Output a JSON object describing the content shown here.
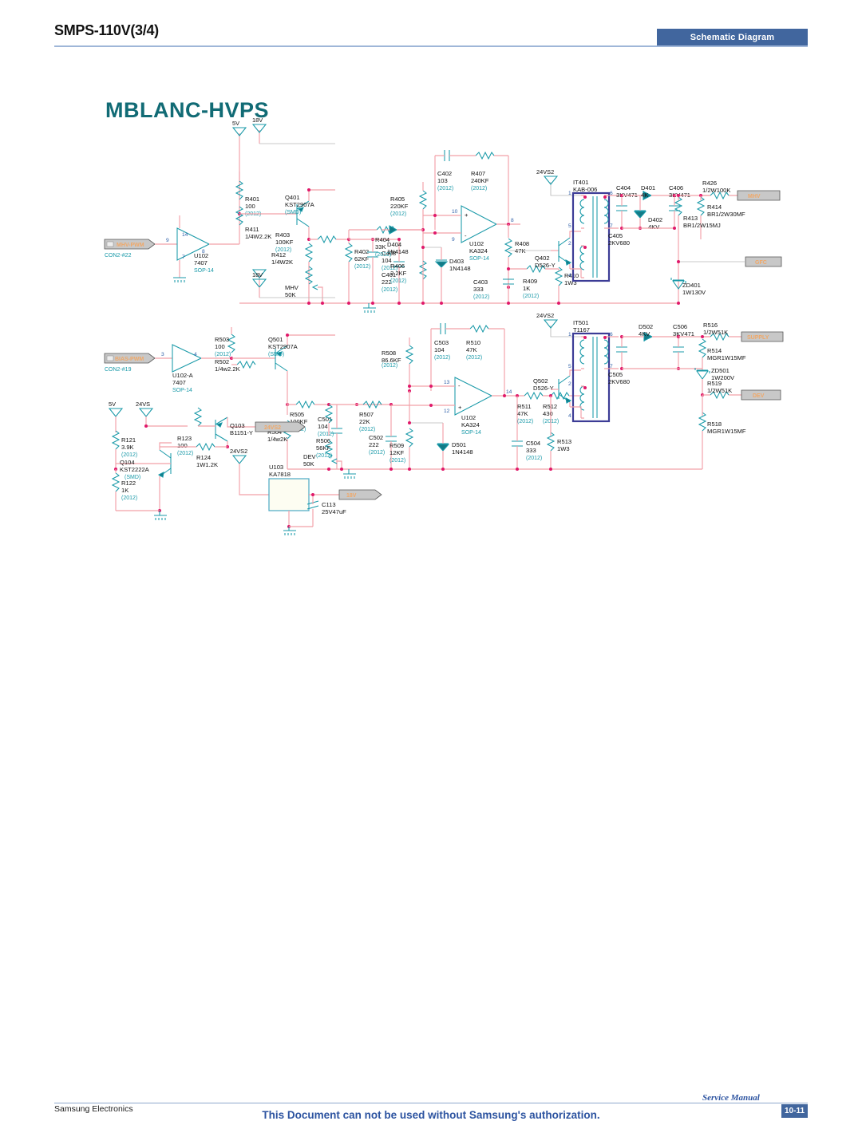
{
  "header": {
    "title": "SMPS-110V(3/4)",
    "badge": "Schematic Diagram"
  },
  "footer": {
    "company": "Samsung Electronics",
    "notice": "This Document can not be used without Samsung's authorization.",
    "manual": "Service Manual",
    "page": "10-11"
  },
  "board": {
    "title": "MBLANC-HVPS"
  },
  "nets": {
    "mhv_pwm": "MHV-PWM",
    "mhv_pwm_con": "CON2-#22",
    "bias_pwm": "BIAS-PWM",
    "bias_pwm_con": "CON2-#19",
    "mhv_out": "MHV",
    "gfc_out": "GFC",
    "supply_out": "SUPPLY",
    "dev_out": "DEV",
    "v24vs2_tag": "24VS2",
    "v18_tag": "18V"
  },
  "rails": {
    "r5v_a": "5V",
    "r18v_a": "18V",
    "r24vs2_a": "24VS2",
    "r18v_b": "18V",
    "r24vs2_b": "24VS2",
    "r5v_c": "5V",
    "r24vs_c": "24VS",
    "r24vs2_c": "24VS2"
  },
  "components": {
    "top": [
      {
        "id": "U102",
        "value": "7407",
        "pkg": "SOP-14",
        "pins": [
          "9",
          "14",
          "8",
          "7"
        ]
      },
      {
        "id": "R401",
        "value": "100",
        "pkg": "(2012)"
      },
      {
        "id": "R411",
        "value": "1/4W2.2K",
        "pkg": ""
      },
      {
        "id": "Q401",
        "value": "KST2907A",
        "pkg": "(SMD)"
      },
      {
        "id": "R403",
        "value": "100KF",
        "pkg": "(2012)"
      },
      {
        "id": "R412",
        "value": "1/4W2K",
        "pkg": ""
      },
      {
        "id": "R402",
        "value": "62KF",
        "pkg": "(2012)"
      },
      {
        "id": "C408",
        "value": "104",
        "pkg": "(2012)"
      },
      {
        "id": "MHV",
        "value": "50K",
        "pkg": ""
      },
      {
        "id": "R404",
        "value": "33K",
        "pkg": "(2012)"
      },
      {
        "id": "C401",
        "value": "222",
        "pkg": "(2012)"
      },
      {
        "id": "R405",
        "value": "220KF",
        "pkg": "(2012)"
      },
      {
        "id": "D404",
        "value": "1N4148",
        "pkg": ""
      },
      {
        "id": "R406",
        "value": "2.2KF",
        "pkg": "(2012)"
      },
      {
        "id": "D403",
        "value": "1N4148",
        "pkg": ""
      },
      {
        "id": "C402",
        "value": "103",
        "pkg": "(2012)"
      },
      {
        "id": "R407",
        "value": "240KF",
        "pkg": "(2012)"
      },
      {
        "id": "U102b",
        "value": "KA324",
        "pkg": "SOP-14",
        "pins": [
          "10",
          "9",
          "8"
        ]
      },
      {
        "id": "R408",
        "value": "47K",
        "pkg": ""
      },
      {
        "id": "C403",
        "value": "333",
        "pkg": "(2012)"
      },
      {
        "id": "R409",
        "value": "1K",
        "pkg": "(2012)"
      },
      {
        "id": "R410",
        "value": "1W3",
        "pkg": ""
      },
      {
        "id": "Q402",
        "value": "D526-Y",
        "pkg": ""
      },
      {
        "id": "IT401",
        "value": "KAB-006",
        "pkg": "",
        "pins": [
          "1",
          "5",
          "2",
          "4",
          "6",
          "7"
        ]
      },
      {
        "id": "C404",
        "value": "3KV471",
        "pkg": ""
      },
      {
        "id": "D401",
        "value": "4K",
        "pkg": ""
      },
      {
        "id": "C406",
        "value": "3KV471",
        "pkg": ""
      },
      {
        "id": "R426",
        "value": "1/2W100K",
        "pkg": ""
      },
      {
        "id": "D402",
        "value": "4KV",
        "pkg": ""
      },
      {
        "id": "C405",
        "value": "2KV680",
        "pkg": ""
      },
      {
        "id": "R414",
        "value": "BR1/2W30MF",
        "pkg": ""
      },
      {
        "id": "R413",
        "value": "BR1/2W15MJ",
        "pkg": ""
      },
      {
        "id": "ZD401",
        "value": "1W130V",
        "pkg": ""
      }
    ],
    "bottom": [
      {
        "id": "U102-A",
        "value": "7407",
        "pkg": "SOP-14",
        "pins": [
          "3",
          "4"
        ]
      },
      {
        "id": "R503",
        "value": "100",
        "pkg": "(2012)"
      },
      {
        "id": "R502",
        "value": "1/4w2.2K",
        "pkg": ""
      },
      {
        "id": "Q501",
        "value": "KST2907A",
        "pkg": "(SMD)"
      },
      {
        "id": "R505",
        "value": "100KF",
        "pkg": "(2012)"
      },
      {
        "id": "R504",
        "value": "1/4w2K",
        "pkg": ""
      },
      {
        "id": "C501",
        "value": "104",
        "pkg": "(2012)"
      },
      {
        "id": "R506",
        "value": "56KF",
        "pkg": "(2012)"
      },
      {
        "id": "DEV",
        "value": "50K",
        "pkg": ""
      },
      {
        "id": "R507",
        "value": "22K",
        "pkg": "(2012)"
      },
      {
        "id": "C502",
        "value": "222",
        "pkg": "(2012)"
      },
      {
        "id": "R508",
        "value": "86.6KF",
        "pkg": "(2012)"
      },
      {
        "id": "R509",
        "value": "12KF",
        "pkg": "(2012)"
      },
      {
        "id": "D501",
        "value": "1N4148",
        "pkg": ""
      },
      {
        "id": "C503",
        "value": "104",
        "pkg": "(2012)"
      },
      {
        "id": "R510",
        "value": "47K",
        "pkg": "(2012)"
      },
      {
        "id": "U102c",
        "value": "KA324",
        "pkg": "SOP-14",
        "pins": [
          "13",
          "12",
          "14"
        ]
      },
      {
        "id": "R511",
        "value": "47K",
        "pkg": "(2012)"
      },
      {
        "id": "R512",
        "value": "430",
        "pkg": "(2012)"
      },
      {
        "id": "C504",
        "value": "333",
        "pkg": "(2012)"
      },
      {
        "id": "R513",
        "value": "1W3",
        "pkg": ""
      },
      {
        "id": "Q502",
        "value": "D526-Y",
        "pkg": ""
      },
      {
        "id": "IT501",
        "value": "T1167",
        "pkg": "",
        "pins": [
          "1",
          "5",
          "2",
          "4",
          "6",
          "7"
        ]
      },
      {
        "id": "D502",
        "value": "4KV",
        "pkg": ""
      },
      {
        "id": "C506",
        "value": "3KV471",
        "pkg": ""
      },
      {
        "id": "C505",
        "value": "2KV680",
        "pkg": ""
      },
      {
        "id": "R516",
        "value": "1/2W51K",
        "pkg": ""
      },
      {
        "id": "R514",
        "value": "MGR1W15MF",
        "pkg": ""
      },
      {
        "id": "ZD501",
        "value": "1W200V",
        "pkg": ""
      },
      {
        "id": "R519",
        "value": "1/2W51K",
        "pkg": ""
      },
      {
        "id": "R518",
        "value": "MGR1W15MF",
        "pkg": ""
      }
    ],
    "regulator": [
      {
        "id": "R121",
        "value": "3.9K",
        "pkg": "(2012)"
      },
      {
        "id": "R122",
        "value": "1K",
        "pkg": "(2012)"
      },
      {
        "id": "Q104",
        "value": "KST2222A",
        "pkg": "(SMD)"
      },
      {
        "id": "R123",
        "value": "100",
        "pkg": "(2012)"
      },
      {
        "id": "Q103",
        "value": "B1151-Y",
        "pkg": ""
      },
      {
        "id": "R124",
        "value": "1W1.2K",
        "pkg": ""
      },
      {
        "id": "U103",
        "value": "KA7818",
        "pkg": ""
      },
      {
        "id": "C113",
        "value": "25V47uF",
        "pkg": ""
      }
    ]
  },
  "labels": {
    "u102_ref": "U102",
    "u102_val": "7407",
    "u102_pkg": "SOP-14",
    "r401_ref": "R401",
    "r401_val": "100",
    "r401_pkg": "(2012)",
    "r411_ref": "R411",
    "r411_val": "1/4W2.2K",
    "q401_ref": "Q401",
    "q401_val": "KST2907A",
    "q401_pkg": "(SMD)",
    "r403_ref": "R403",
    "r403_val": "100KF",
    "r403_pkg": "(2012)",
    "r412_ref": "R412",
    "r412_val": "1/4W2K",
    "r402_ref": "R402",
    "r402_val": "62KF",
    "r402_pkg": "(2012)",
    "c408_ref": "C408",
    "c408_val": "104",
    "c408_pkg": "(2012)",
    "mhvpot_ref": "MHV",
    "mhvpot_val": "50K",
    "r404_ref": "R404",
    "r404_val": "33K",
    "r404_pkg": "(2012)",
    "c401_ref": "C401",
    "c401_val": "222",
    "c401_pkg": "(2012)",
    "r405_ref": "R405",
    "r405_val": "220KF",
    "r405_pkg": "(2012)",
    "d404_ref": "D404",
    "d404_val": "1N4148",
    "r406_ref": "R406",
    "r406_val": "2.2KF",
    "r406_pkg": "(2012)",
    "d403_ref": "D403",
    "d403_val": "1N4148",
    "c402_ref": "C402",
    "c402_val": "103",
    "c402_pkg": "(2012)",
    "r407_ref": "R407",
    "r407_val": "240KF",
    "r407_pkg": "(2012)",
    "u102b_ref": "U102",
    "u102b_val": "KA324",
    "u102b_pkg": "SOP-14",
    "r408_ref": "R408",
    "r408_val": "47K",
    "c403_ref": "C403",
    "c403_val": "333",
    "c403_pkg": "(2012)",
    "r409_ref": "R409",
    "r409_val": "1K",
    "r409_pkg": "(2012)",
    "r410_ref": "R410",
    "r410_val": "1W3",
    "q402_ref": "Q402",
    "q402_val": "D526-Y",
    "it401_ref": "IT401",
    "it401_val": "KAB-006",
    "c404_ref": "C404",
    "c404_val": "3KV471",
    "d401_ref": "D401",
    "d401_val": "4K",
    "c406_ref": "C406",
    "c406_val": "3KV471",
    "r426_ref": "R426",
    "r426_val": "1/2W100K",
    "d402_ref": "D402",
    "d402_val": "4KV",
    "c405_ref": "C405",
    "c405_val": "2KV680",
    "r414_ref": "R414",
    "r414_val": "BR1/2W30MF",
    "r413_ref": "R413",
    "r413_val": "BR1/2W15MJ",
    "zd401_ref": "ZD401",
    "zd401_val": "1W130V",
    "u102a_ref": "U102-A",
    "u102a_val": "7407",
    "u102a_pkg": "SOP-14",
    "r503_ref": "R503",
    "r503_val": "100",
    "r503_pkg": "(2012)",
    "r502_ref": "R502",
    "r502_val": "1/4w2.2K",
    "q501_ref": "Q501",
    "q501_val": "KST2907A",
    "q501_pkg": "(SMD)",
    "r505_ref": "R505",
    "r505_val": "100KF",
    "r505_pkg": "(2012)",
    "r504_ref": "R504",
    "r504_val": "1/4w2K",
    "c501_ref": "C501",
    "c501_val": "104",
    "c501_pkg": "(2012)",
    "r506_ref": "R506",
    "r506_val": "56KF",
    "r506_pkg": "(2012)",
    "devpot_ref": "DEV",
    "devpot_val": "50K",
    "r507_ref": "R507",
    "r507_val": "22K",
    "r507_pkg": "(2012)",
    "c502_ref": "C502",
    "c502_val": "222",
    "c502_pkg": "(2012)",
    "r508_ref": "R508",
    "r508_val": "86.6KF",
    "r508_pkg": "(2012)",
    "r509_ref": "R509",
    "r509_val": "12KF",
    "r509_pkg": "(2012)",
    "d501_ref": "D501",
    "d501_val": "1N4148",
    "c503_ref": "C503",
    "c503_val": "104",
    "c503_pkg": "(2012)",
    "r510_ref": "R510",
    "r510_val": "47K",
    "r510_pkg": "(2012)",
    "u102c_ref": "U102",
    "u102c_val": "KA324",
    "u102c_pkg": "SOP-14",
    "r511_ref": "R511",
    "r511_val": "47K",
    "r511_pkg": "(2012)",
    "r512_ref": "R512",
    "r512_val": "430",
    "r512_pkg": "(2012)",
    "c504_ref": "C504",
    "c504_val": "333",
    "c504_pkg": "(2012)",
    "r513_ref": "R513",
    "r513_val": "1W3",
    "q502_ref": "Q502",
    "q502_val": "D526-Y",
    "it501_ref": "IT501",
    "it501_val": "T1167",
    "d502_ref": "D502",
    "d502_val": "4KV",
    "c506_ref": "C506",
    "c506_val": "3KV471",
    "c505_ref": "C505",
    "c505_val": "2KV680",
    "r516_ref": "R516",
    "r516_val": "1/2W51K",
    "r514_ref": "R514",
    "r514_val": "MGR1W15MF",
    "zd501_ref": "ZD501",
    "zd501_val": "1W200V",
    "r519_ref": "R519",
    "r519_val": "1/2W51K",
    "r518_ref": "R518",
    "r518_val": "MGR1W15MF",
    "r121_ref": "R121",
    "r121_val": "3.9K",
    "r121_pkg": "(2012)",
    "r122_ref": "R122",
    "r122_val": "1K",
    "r122_pkg": "(2012)",
    "q104_ref": "Q104",
    "q104_val": "KST2222A",
    "q104_pkg": "(SMD)",
    "r123_ref": "R123",
    "r123_val": "100",
    "r123_pkg": "(2012)",
    "q103_ref": "Q103",
    "q103_val": "B1151-Y",
    "r124_ref": "R124",
    "r124_val": "1W1.2K",
    "u103_ref": "U103",
    "u103_val": "KA7818",
    "c113_ref": "C113",
    "c113_val": "25V47uF",
    "pin9": "9",
    "pin14": "14",
    "pin8": "8",
    "pin7": "7",
    "pin10": "10",
    "pin9b": "9",
    "pin8b": "8",
    "pin3": "3",
    "pin4": "4",
    "pin13": "13",
    "pin12": "12",
    "pin14b": "14",
    "xp1": "1",
    "xp5": "5",
    "xp2": "2",
    "xp4": "4",
    "xp6": "6",
    "xp7": "7",
    "yp1": "1",
    "yp5": "5",
    "yp2": "2",
    "yp4": "4",
    "yp6": "6",
    "yp7": "7"
  }
}
